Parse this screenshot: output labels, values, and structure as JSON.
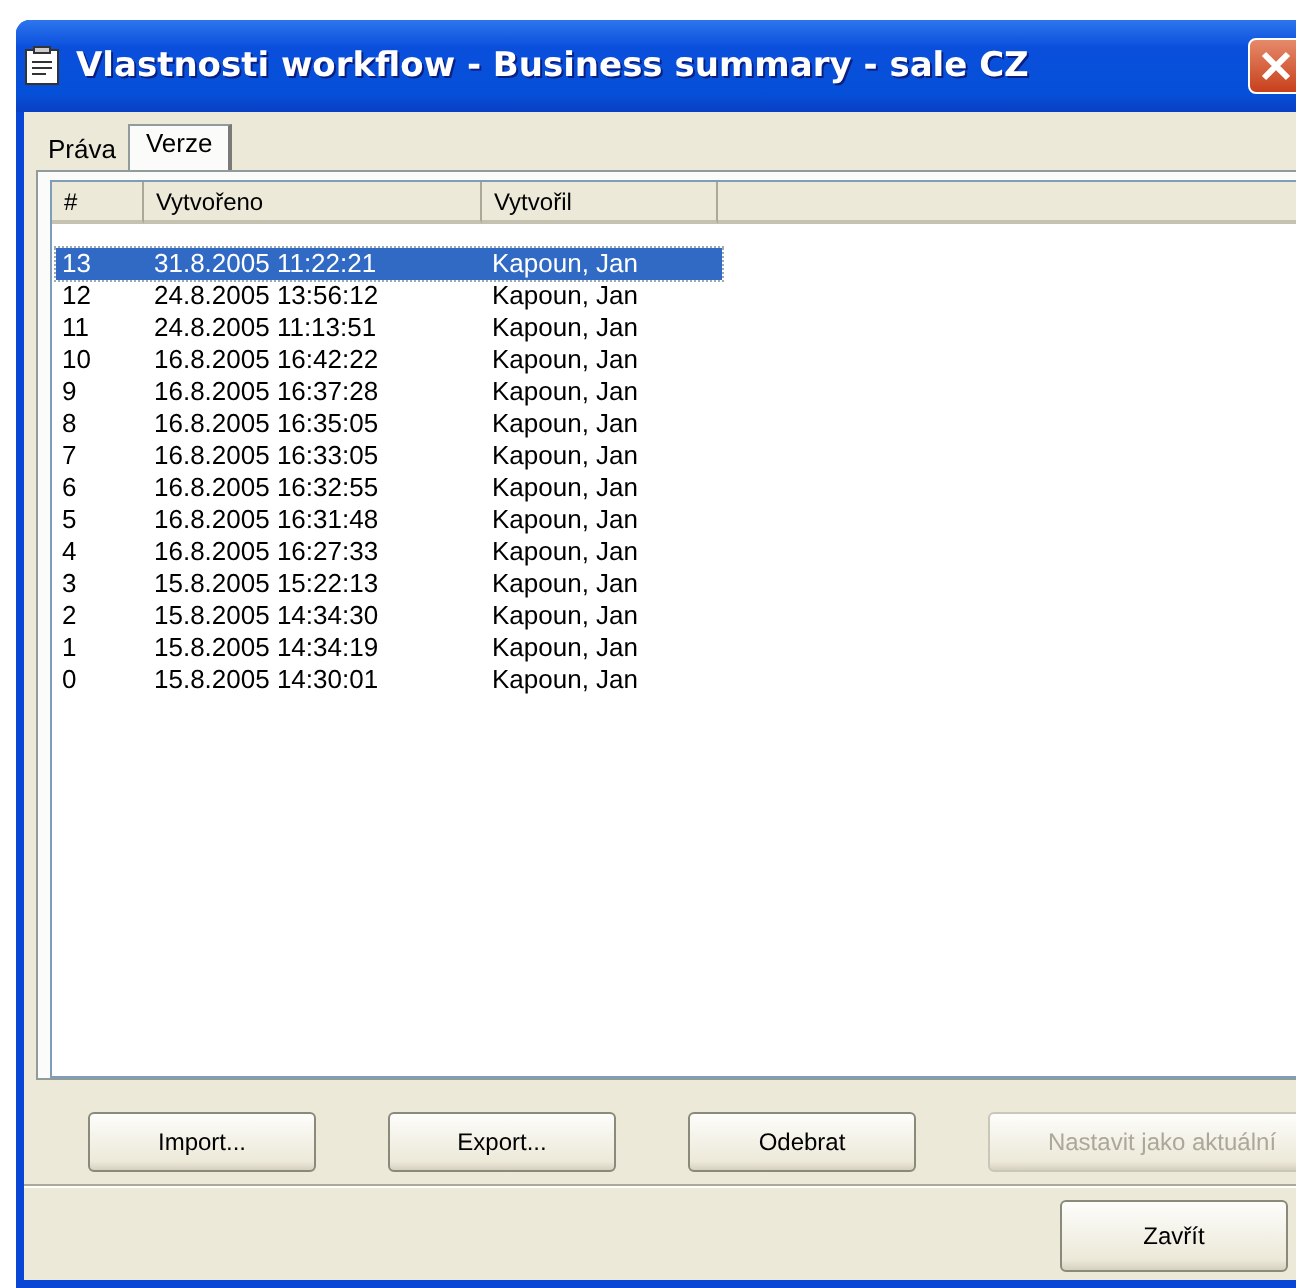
{
  "window": {
    "title": "Vlastnosti workflow - Business summary - sale CZ"
  },
  "tabs": [
    {
      "label": "Práva",
      "selected": false
    },
    {
      "label": "Verze",
      "selected": true
    }
  ],
  "table": {
    "columns": [
      "#",
      "Vytvořeno",
      "Vytvořil"
    ],
    "rows": [
      {
        "cells": [
          "13",
          "31.8.2005 11:22:21",
          "Kapoun, Jan"
        ],
        "selected": true
      },
      {
        "cells": [
          "12",
          "24.8.2005 13:56:12",
          "Kapoun, Jan"
        ],
        "selected": false
      },
      {
        "cells": [
          "11",
          "24.8.2005 11:13:51",
          "Kapoun, Jan"
        ],
        "selected": false
      },
      {
        "cells": [
          "10",
          "16.8.2005 16:42:22",
          "Kapoun, Jan"
        ],
        "selected": false
      },
      {
        "cells": [
          "9",
          "16.8.2005 16:37:28",
          "Kapoun, Jan"
        ],
        "selected": false
      },
      {
        "cells": [
          "8",
          "16.8.2005 16:35:05",
          "Kapoun, Jan"
        ],
        "selected": false
      },
      {
        "cells": [
          "7",
          "16.8.2005 16:33:05",
          "Kapoun, Jan"
        ],
        "selected": false
      },
      {
        "cells": [
          "6",
          "16.8.2005 16:32:55",
          "Kapoun, Jan"
        ],
        "selected": false
      },
      {
        "cells": [
          "5",
          "16.8.2005 16:31:48",
          "Kapoun, Jan"
        ],
        "selected": false
      },
      {
        "cells": [
          "4",
          "16.8.2005 16:27:33",
          "Kapoun, Jan"
        ],
        "selected": false
      },
      {
        "cells": [
          "3",
          "15.8.2005 15:22:13",
          "Kapoun, Jan"
        ],
        "selected": false
      },
      {
        "cells": [
          "2",
          "15.8.2005 14:34:30",
          "Kapoun, Jan"
        ],
        "selected": false
      },
      {
        "cells": [
          "1",
          "15.8.2005 14:34:19",
          "Kapoun, Jan"
        ],
        "selected": false
      },
      {
        "cells": [
          "0",
          "15.8.2005 14:30:01",
          "Kapoun, Jan"
        ],
        "selected": false
      }
    ]
  },
  "buttons": [
    {
      "label": "Import...",
      "disabled": false
    },
    {
      "label": "Export...",
      "disabled": false
    },
    {
      "label": "Odebrat",
      "disabled": false
    },
    {
      "label": "Nastavit jako aktuální",
      "disabled": true
    }
  ],
  "footer_buttons": [
    {
      "label": "Zavřít"
    }
  ]
}
